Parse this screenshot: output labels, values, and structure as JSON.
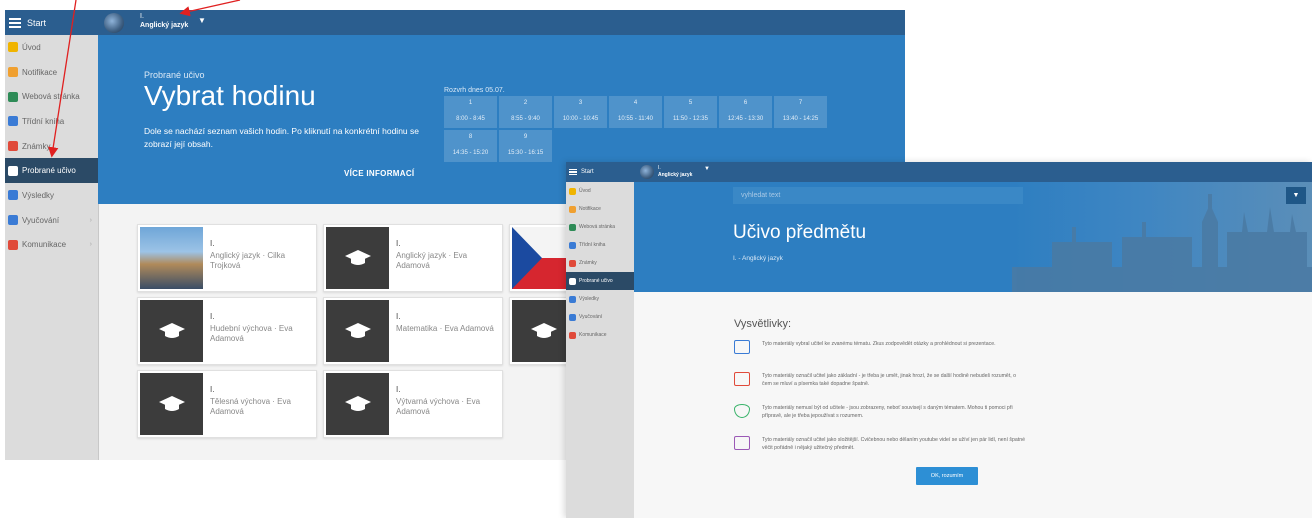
{
  "w1": {
    "sidebar": {
      "start": "Start",
      "items": [
        {
          "label": "Úvod",
          "icon": "star-icon",
          "color": "#f0b400"
        },
        {
          "label": "Notifikace",
          "icon": "envelope-icon",
          "color": "#f0a030"
        },
        {
          "label": "Webová stránka",
          "icon": "house-icon",
          "color": "#2e8b57"
        },
        {
          "label": "Třídní kniha",
          "icon": "book-icon",
          "color": "#3a7bd5"
        },
        {
          "label": "Známky",
          "icon": "grade-icon",
          "color": "#e04a3a"
        },
        {
          "label": "Probrané učivo",
          "icon": "whiteboard-icon",
          "color": "#ffffff"
        },
        {
          "label": "Výsledky",
          "icon": "bar-chart-icon",
          "color": "#3a7bd5"
        },
        {
          "label": "Vyučování",
          "icon": "briefcase-icon",
          "color": "#3a7bd5"
        },
        {
          "label": "Komunikace",
          "icon": "people-icon",
          "color": "#e04a3a"
        }
      ]
    },
    "topbar": {
      "class": "I.",
      "subject": "Anglický jazyk"
    },
    "hero": {
      "small": "Probrané učivo",
      "title": "Vybrat hodinu",
      "desc": "Dole se nachází seznam vašich hodin. Po kliknutí na konkrétní hodinu se zobrazí její obsah.",
      "more": "VÍCE INFORMACÍ",
      "rozvrh_title": "Rozvrh dnes 05.07.",
      "rozvrh": [
        {
          "n": "1",
          "t": "8:00 - 8:45"
        },
        {
          "n": "2",
          "t": "8:55 - 9:40"
        },
        {
          "n": "3",
          "t": "10:00 - 10:45"
        },
        {
          "n": "4",
          "t": "10:55 - 11:40"
        },
        {
          "n": "5",
          "t": "11:50 - 12:35"
        },
        {
          "n": "6",
          "t": "12:45 - 13:30"
        },
        {
          "n": "7",
          "t": "13:40 - 14:25"
        },
        {
          "n": "8",
          "t": "14:35 - 15:20"
        },
        {
          "n": "9",
          "t": "15:30 - 16:15"
        }
      ]
    },
    "cards": [
      {
        "class": "I.",
        "subject": "Anglický jazyk · Cilka Trojková"
      },
      {
        "class": "I.",
        "subject": "Anglický jazyk · Eva Adamová"
      },
      {
        "class": "I.",
        "subject": "Hudební výchova · Eva Adamová"
      },
      {
        "class": "I.",
        "subject": "Matematika · Eva Adamová"
      },
      {
        "class": "I.",
        "subject": "Tělesná výchova · Eva Adamová"
      },
      {
        "class": "I.",
        "subject": "Výtvarná výchova · Eva Adamová"
      }
    ]
  },
  "w2": {
    "sidebar": {
      "start": "Start",
      "items": [
        {
          "label": "Úvod"
        },
        {
          "label": "Notifikace"
        },
        {
          "label": "Webová stránka"
        },
        {
          "label": "Třídní kniha"
        },
        {
          "label": "Známky"
        },
        {
          "label": "Probrané učivo"
        },
        {
          "label": "Výsledky"
        },
        {
          "label": "Vyučování"
        },
        {
          "label": "Komunikace"
        }
      ]
    },
    "topbar": {
      "class": "I.",
      "subject": "Anglický jazyk"
    },
    "search_placeholder": "vyhledat text",
    "title": "Učivo předmětu",
    "subtitle": "I. - Anglický jazyk",
    "legend_title": "Vysvětlivky:",
    "legend": [
      {
        "text": "Tyto materiály vybral učitel ke zvanému tématu. Zkus zodpovědět otázky a prohlédnout si prezentace.",
        "color": "#3a7bd5"
      },
      {
        "text": "Tyto materiály označil učitel jako základní - je třeba je umět, jinak hrozí, že se další hodině nebudeš rozumět, o čem se mluví a písemka také dopadne špatně.",
        "color": "#e04a3a"
      },
      {
        "text": "Tyto materiály nemusí být od učitele - jsou zobrazeny, neboť souvisejí s daným tématem. Mohou ti pomoci při přípravě, ale je třeba jepoužívat s rozumem.",
        "color": "#39b36a"
      },
      {
        "text": "Tyto materiály označil učitel jako složitější. Cvičebnou nebo dělaním youtube videí se užíví jen pár lidí, není špatné věčit pořádně i nějaký užitečný předmět.",
        "color": "#9b59b6"
      }
    ],
    "ok": "OK, rozumím"
  }
}
